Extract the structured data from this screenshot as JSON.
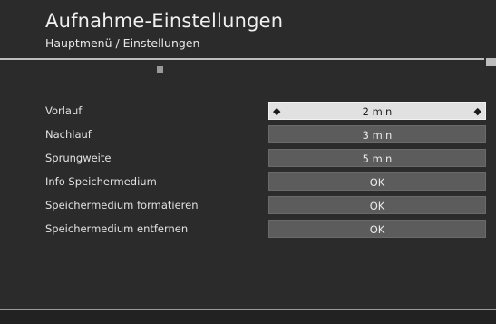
{
  "header": {
    "title": "Aufnahme-Einstellungen",
    "breadcrumb": "Hauptmenü / Einstellungen"
  },
  "settings": {
    "rows": [
      {
        "label": "Vorlauf",
        "value": "2 min",
        "selected": true
      },
      {
        "label": "Nachlauf",
        "value": "3 min"
      },
      {
        "label": "Sprungweite",
        "value": "5 min"
      },
      {
        "label": "Info Speichermedium",
        "value": "OK"
      },
      {
        "label": "Speichermedium formatieren",
        "value": "OK"
      },
      {
        "label": "Speichermedium entfernen",
        "value": "OK"
      }
    ]
  },
  "icons": {
    "left_arrow": "left-arrow-icon",
    "right_arrow": "right-arrow-icon"
  },
  "colors": {
    "background": "#2b2b2b",
    "button": "#5c5c5c",
    "selected_button": "#e1e1e1"
  }
}
